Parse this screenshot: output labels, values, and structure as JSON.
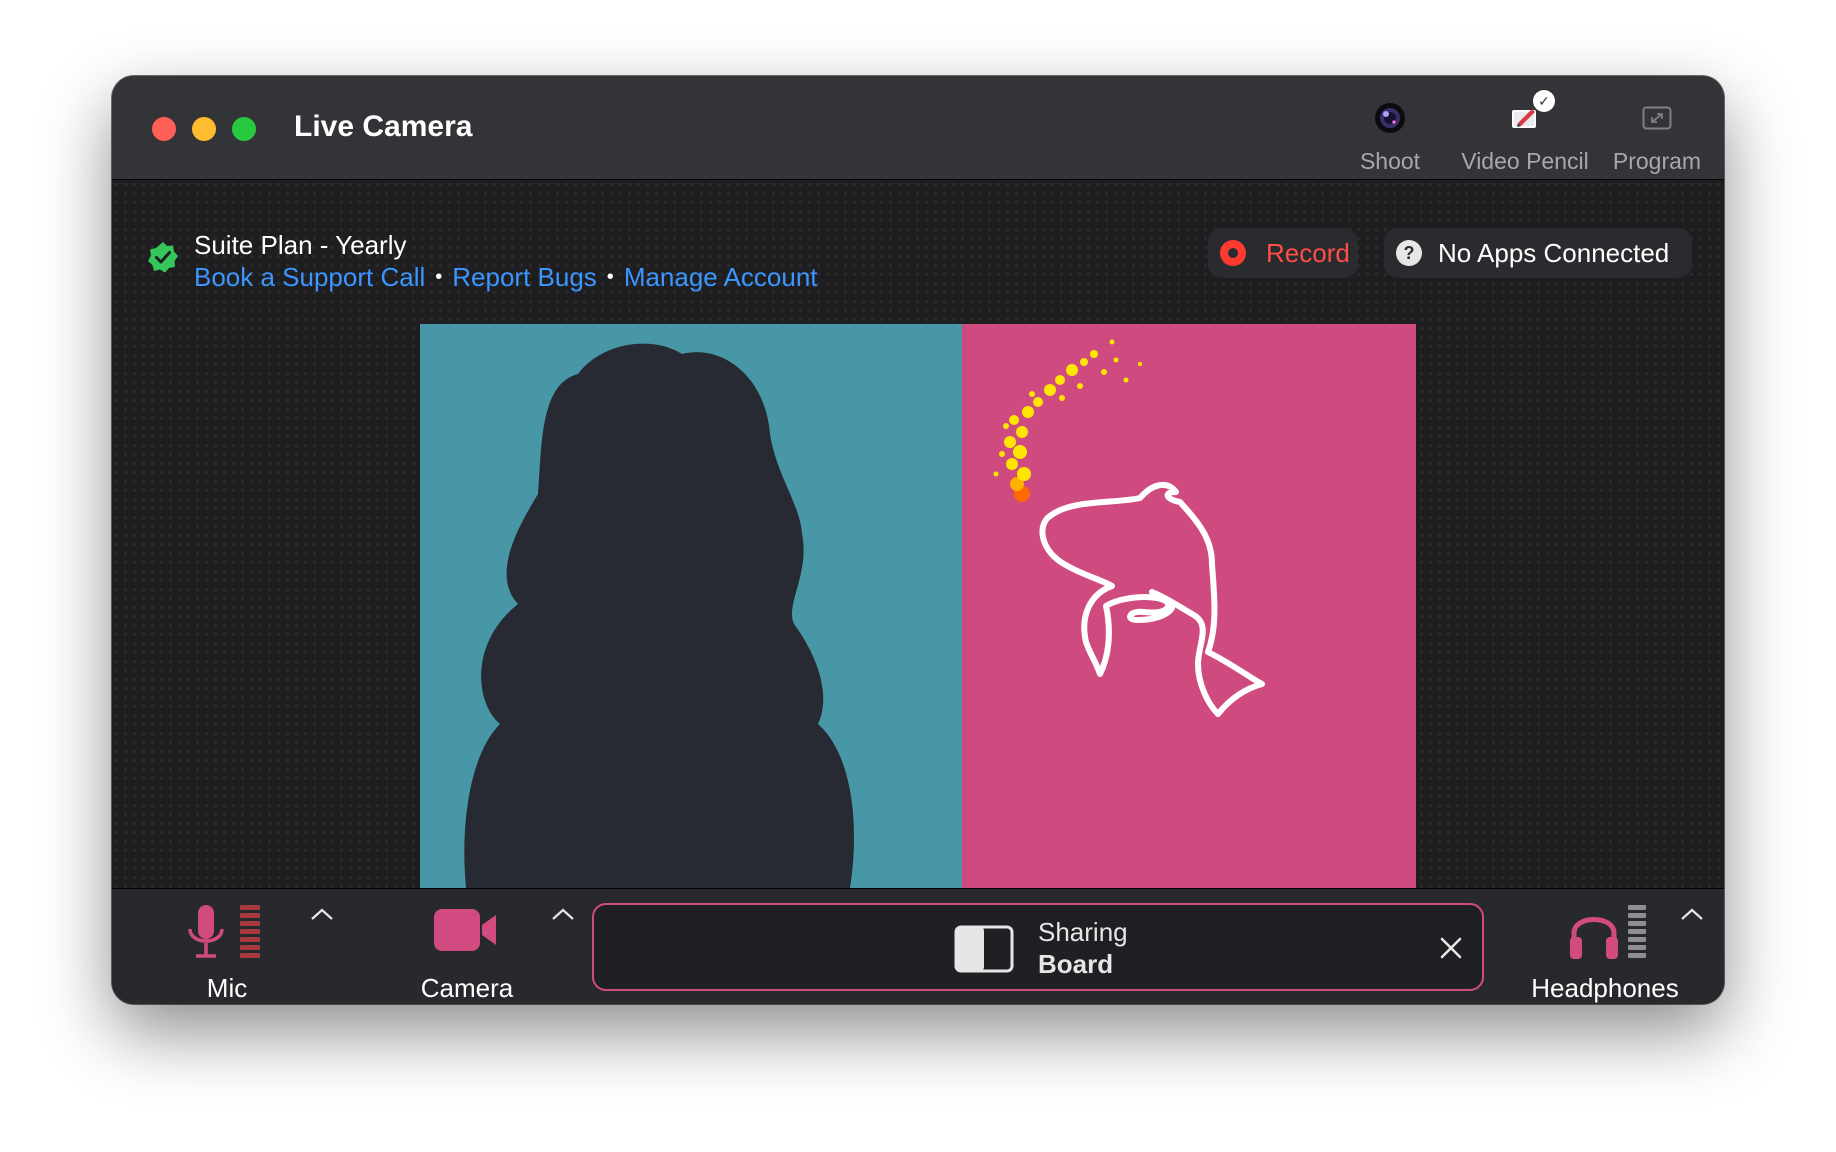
{
  "window": {
    "title": "Live Camera"
  },
  "toolbar": {
    "tools": [
      {
        "label": "Shoot",
        "icon": "camera-lens-icon"
      },
      {
        "label": "Video Pencil",
        "icon": "video-pencil-icon",
        "checked": true
      },
      {
        "label": "Program",
        "icon": "expand-icon"
      }
    ]
  },
  "plan": {
    "name": "Suite Plan - Yearly",
    "links": [
      "Book a Support Call",
      "Report Bugs",
      "Manage Account"
    ],
    "separator": "•",
    "status_icon": "verified-check-icon"
  },
  "record": {
    "label": "Record",
    "icon": "record-icon"
  },
  "apps": {
    "label": "No Apps Connected",
    "icon": "question-icon"
  },
  "video": {
    "left_bg": "#4897a6",
    "right_bg": "#cf4a7f",
    "silhouette": "#272a33",
    "drawing_color": "#ffffff"
  },
  "controls": {
    "mic": {
      "label": "Mic",
      "icon": "microphone-icon"
    },
    "camera": {
      "label": "Camera",
      "icon": "video-camera-icon"
    },
    "sharing": {
      "title": "Sharing",
      "subtitle": "Board",
      "icon": "board-icon"
    },
    "headphones": {
      "label": "Headphones",
      "icon": "headphones-icon"
    }
  },
  "colors": {
    "accent": "#d24b80",
    "link": "#3b96ff",
    "record": "#ff4d47",
    "verified": "#34c759"
  }
}
